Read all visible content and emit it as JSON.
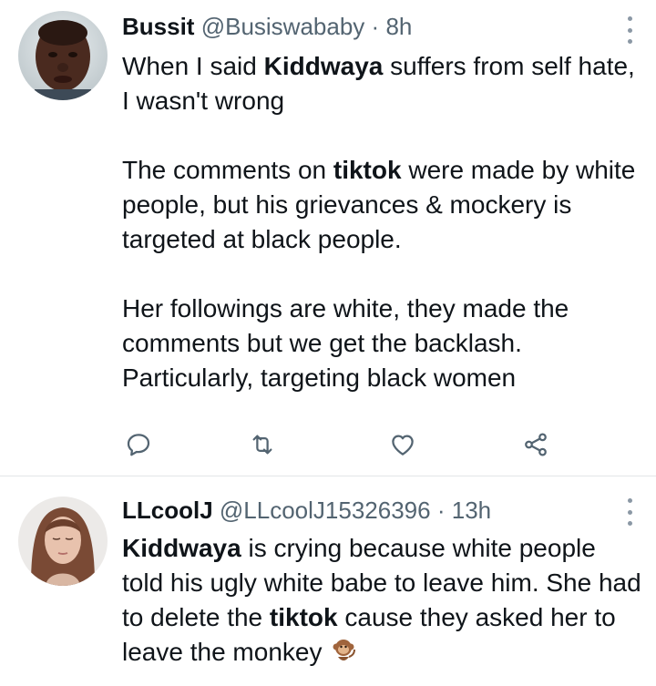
{
  "tweets": [
    {
      "display_name": "Bussit",
      "handle": "@Busiswababy",
      "separator": "·",
      "time": "8h",
      "paragraphs": [
        [
          {
            "text": "When I said ",
            "bold": false
          },
          {
            "text": "Kiddwaya",
            "bold": true
          },
          {
            "text": " suffers from self hate, I wasn't wrong",
            "bold": false
          }
        ],
        [
          {
            "text": "The comments on ",
            "bold": false
          },
          {
            "text": "tiktok",
            "bold": true
          },
          {
            "text": " were made by white people, but his grievances & mockery is targeted at black people.",
            "bold": false
          }
        ],
        [
          {
            "text": "Her followings are white, they made the comments but we get the backlash. Particularly, targeting black women",
            "bold": false
          }
        ]
      ],
      "actions": {
        "reply_icon": "reply-icon",
        "retweet_icon": "retweet-icon",
        "like_icon": "heart-icon",
        "share_icon": "share-icon"
      }
    },
    {
      "display_name": "LLcoolJ",
      "handle": "@LLcoolJ15326396",
      "separator": "·",
      "time": "13h",
      "paragraphs": [
        [
          {
            "text": "Kiddwaya",
            "bold": true
          },
          {
            "text": " is crying because white people told his ugly white babe to leave him. She had to delete the ",
            "bold": false
          },
          {
            "text": "tiktok",
            "bold": true
          },
          {
            "text": " cause they asked her to leave the monkey ",
            "bold": false
          }
        ]
      ],
      "emoji": "monkey-emoji"
    }
  ],
  "colors": {
    "text": "#0f1419",
    "muted": "#536471",
    "icon": "#536471",
    "divider": "#e3e6e8"
  }
}
